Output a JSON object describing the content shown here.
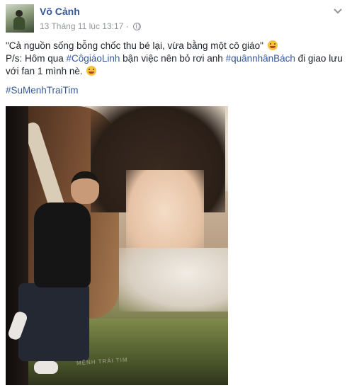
{
  "post": {
    "author": "Võ Cảnh",
    "timestamp": "13 Tháng 11 lúc 13:17",
    "separator": "·",
    "privacy_icon": "globe-icon",
    "menu_icon": "chevron-down-icon",
    "text_line1": "\"Cả nguồn sống bỗng chốc thu bé lại, vừa bằng một cô giáo\"",
    "text_line2_prefix": "P/s: Hôm qua ",
    "hashtag1": "#CôgiáoLinh",
    "text_line2_mid": " bận việc nên bỏ rơi anh ",
    "hashtag2": "#quânnhânBách",
    "text_line2_suffix": " đi giao lưu với fan 1 mình nè.",
    "hashtag3": "#SuMenhTraiTim",
    "photo_caption": "MỆNH TRÁI TIM"
  },
  "colors": {
    "link": "#365899",
    "meta": "#90949c",
    "text": "#1d2129"
  }
}
